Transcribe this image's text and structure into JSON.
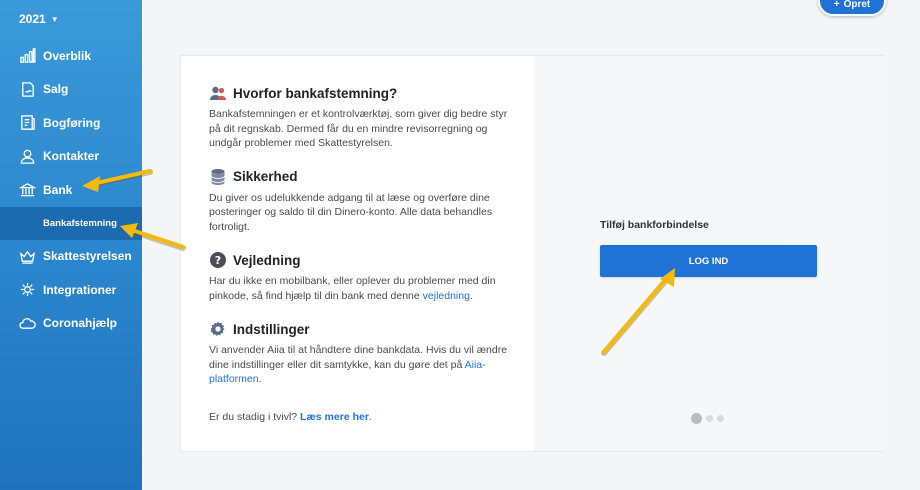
{
  "sidebar": {
    "year": "2021",
    "items": [
      {
        "label": "Overblik",
        "icon": "bar-chart-icon"
      },
      {
        "label": "Salg",
        "icon": "document-icon"
      },
      {
        "label": "Bogføring",
        "icon": "ledger-icon"
      },
      {
        "label": "Kontakter",
        "icon": "user-icon"
      },
      {
        "label": "Bank",
        "icon": "bank-icon"
      }
    ],
    "sub_item": "Bankafstemning",
    "items_after": [
      {
        "label": "Skattestyrelsen",
        "icon": "crown-icon"
      },
      {
        "label": "Integrationer",
        "icon": "integration-icon"
      },
      {
        "label": "Coronahjælp",
        "icon": "cloud-icon"
      }
    ]
  },
  "header": {
    "create_label": "Opret"
  },
  "info": {
    "why": {
      "title": "Hvorfor bankafstemning?",
      "body": "Bankafstemningen er et kontrolværktøj, som giver dig bedre styr på dit regnskab. Dermed får du en mindre revisorregning og undgår problemer med Skattestyrelsen."
    },
    "security": {
      "title": "Sikkerhed",
      "body": "Du giver os udelukkende adgang til at læse og overføre dine posteringer og saldo til din Dinero-konto. Alle data behandles fortroligt."
    },
    "guide": {
      "title": "Vejledning",
      "body": "Har du ikke en mobilbank, eller oplever du problemer med din pinkode, så find hjælp til din bank med denne ",
      "link": "vejledning",
      "end": "."
    },
    "settings": {
      "title": "Indstillinger",
      "body": "Vi anvender Aiia til at håndtere dine bankdata. Hvis du vil ændre dine indstillinger eller dit samtykke, kan du gøre det på ",
      "link": "Aiia-platformen",
      "end": "."
    },
    "footer": {
      "question": "Er du stadig i tvivl? ",
      "link": "Læs mere her",
      "end": "."
    }
  },
  "connect": {
    "label": "Tilføj bankforbindelse",
    "button": "LOG IND",
    "slides": {
      "count": 3,
      "active": 1
    }
  },
  "colors": {
    "sidebar": "#2a85cc",
    "sidebar_active": "#1c6ab0",
    "accent": "#1f73d6",
    "arrow": "#f5b90b"
  }
}
